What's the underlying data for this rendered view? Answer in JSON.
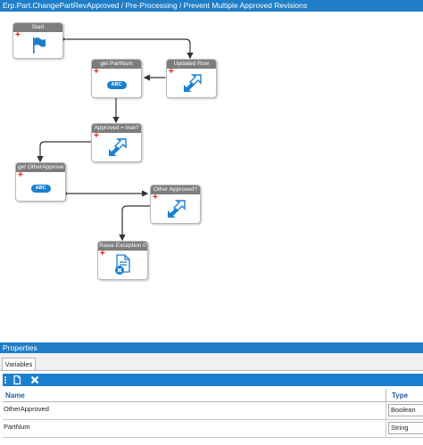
{
  "window": {
    "breadcrumb": "Erp.Part.ChangePartRevApproved / Pre-Processing / Prevent Multiple Approved Revisions"
  },
  "workflow": {
    "nodes": [
      {
        "id": "start",
        "title": "Start",
        "icon": "flag-icon"
      },
      {
        "id": "get-partnum",
        "title": "get PartNum",
        "icon": "abc-variable-icon",
        "badge": "ABC"
      },
      {
        "id": "updated-row",
        "title": "Updated Row",
        "icon": "condition-arrow-icon"
      },
      {
        "id": "approved-true",
        "title": "Approved = true?",
        "icon": "condition-arrow-icon"
      },
      {
        "id": "get-otherapproved",
        "title": "get OtherApprove",
        "icon": "abc-variable-icon",
        "badge": "ABC"
      },
      {
        "id": "other-approved",
        "title": "Other Approved?",
        "icon": "condition-arrow-icon"
      },
      {
        "id": "raise-exception",
        "title": "Raise Exception 0",
        "icon": "document-error-icon"
      }
    ],
    "colors": {
      "accent": "#1f7ec7",
      "node_header": "#7d7d7d",
      "add_marker": "#e41a1a",
      "icon_blue": "#1b7fd0"
    }
  },
  "properties": {
    "title": "Properties",
    "tab": "Variables",
    "toolbar": {
      "new_icon": "new-document-icon",
      "delete_icon": "delete-x-icon"
    },
    "columns": {
      "name": "Name",
      "type": "Type"
    },
    "rows": [
      {
        "name": "OtherApproved",
        "type": "Boolean"
      },
      {
        "name": "PartNum",
        "type": "String"
      }
    ]
  }
}
